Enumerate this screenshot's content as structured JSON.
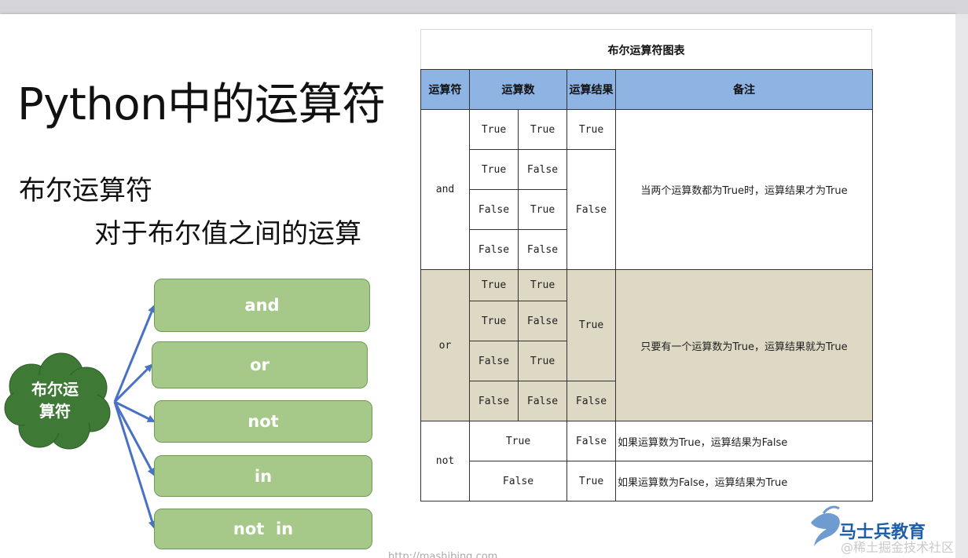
{
  "slide": {
    "title": "Python中的运算符",
    "subtitle": "布尔运算符",
    "subtitle2": "对于布尔值之间的运算"
  },
  "mindmap": {
    "center": "布尔运算符",
    "center_line1": "布尔运",
    "center_line2": "算符",
    "operators": [
      "and",
      "or",
      "not",
      "in",
      "not  in"
    ],
    "box_color": "#a6c98a",
    "cloud_color": "#3e7a35",
    "arrow_color": "#4a72c4"
  },
  "table": {
    "title": "布尔运算符图表",
    "headers": [
      "运算符",
      "运算数",
      "运算结果",
      "备注"
    ],
    "and": {
      "label": "and",
      "rows": [
        [
          "True",
          "True",
          "True"
        ],
        [
          "True",
          "False"
        ],
        [
          "False",
          "True"
        ],
        [
          "False",
          "False"
        ]
      ],
      "false_result": "False",
      "note": "当两个运算数都为True时，运算结果才为True"
    },
    "or": {
      "label": "or",
      "rows": [
        [
          "True",
          "True"
        ],
        [
          "True",
          "False"
        ],
        [
          "False",
          "True"
        ],
        [
          "False",
          "False",
          "False"
        ]
      ],
      "true_result": "True",
      "note": "只要有一个运算数为True，运算结果就为True"
    },
    "not": {
      "label": "not",
      "rows": [
        {
          "operand": "True",
          "result": "False",
          "note": "如果运算数为True，运算结果为False"
        },
        {
          "operand": "False",
          "result": "True",
          "note": "如果运算数为False，运算结果为True"
        }
      ]
    },
    "header_color": "#8db4e2",
    "or_color": "#ddd9c4"
  },
  "footer": {
    "logo": "马士兵教育",
    "watermark": "@稀土掘金技术社区",
    "url": "http://mashibing.com"
  }
}
